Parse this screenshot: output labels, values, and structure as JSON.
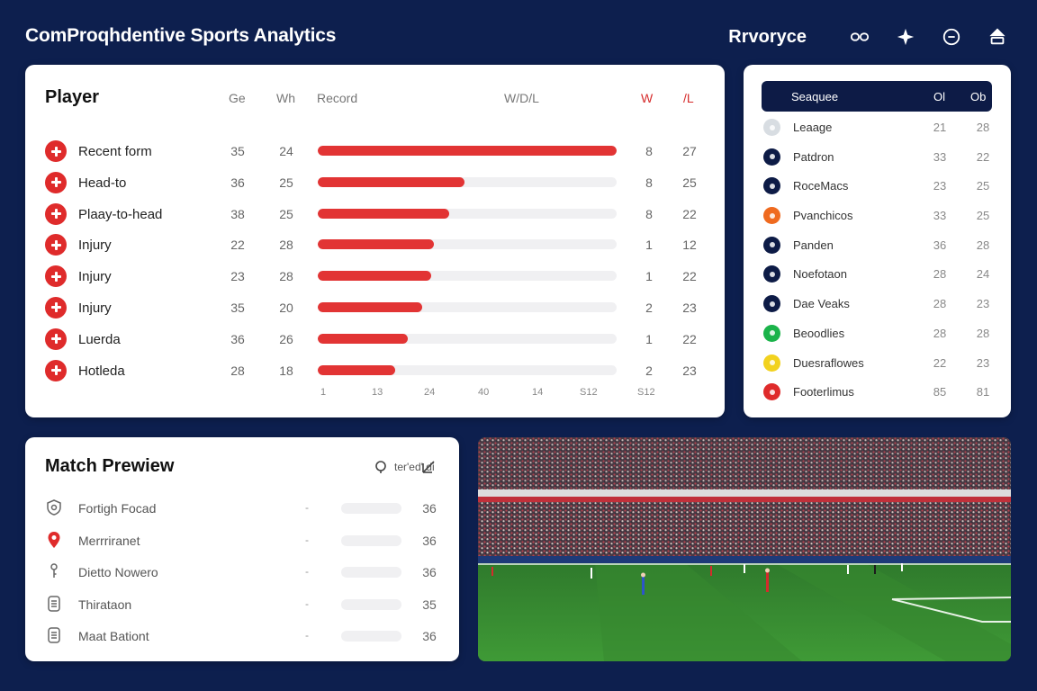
{
  "app": {
    "title": "ComProqhdentive Sports Analytics",
    "user": "Rrvoryce"
  },
  "header_icons": [
    "link-icon",
    "sparkle-icon",
    "minus-circle-icon",
    "upload-icon"
  ],
  "player_card": {
    "title": "Player",
    "columns": {
      "ge": "Ge",
      "wh": "Wh",
      "record": "Record",
      "wdl": "W/D/L",
      "w": "W",
      "l": "/L"
    },
    "rows": [
      {
        "label": "Recent form",
        "ge": "35",
        "wh": "24",
        "fill": 1.0,
        "w": "8",
        "l": "27"
      },
      {
        "label": "Head-to",
        "ge": "36",
        "wh": "25",
        "fill": 0.49,
        "w": "8",
        "l": "25"
      },
      {
        "label": "Plaay-to-head",
        "ge": "38",
        "wh": "25",
        "fill": 0.44,
        "w": "8",
        "l": "22"
      },
      {
        "label": "Injury",
        "ge": "22",
        "wh": "28",
        "fill": 0.39,
        "w": "1",
        "l": "12"
      },
      {
        "label": "Injury",
        "ge": "23",
        "wh": "28",
        "fill": 0.38,
        "w": "1",
        "l": "22"
      },
      {
        "label": "Injury",
        "ge": "35",
        "wh": "20",
        "fill": 0.35,
        "w": "2",
        "l": "23"
      },
      {
        "label": "Luerda",
        "ge": "36",
        "wh": "26",
        "fill": 0.3,
        "w": "1",
        "l": "22"
      },
      {
        "label": "Hotleda",
        "ge": "28",
        "wh": "18",
        "fill": 0.26,
        "w": "2",
        "l": "23"
      }
    ],
    "axis_ticks": [
      "1",
      "13",
      "24",
      "40",
      "14",
      "S12",
      "S12"
    ]
  },
  "league_card": {
    "header": {
      "name": "Seaquee",
      "col1": "Ol",
      "col2": "Ob"
    },
    "rows": [
      {
        "label": "Leaage",
        "a": "21",
        "b": "28",
        "color": "#d8dde2"
      },
      {
        "label": "Patdron",
        "a": "33",
        "b": "22",
        "color": "#0d1b46"
      },
      {
        "label": "RoceMacs",
        "a": "23",
        "b": "25",
        "color": "#0d1b46"
      },
      {
        "label": "Pvanchicos",
        "a": "33",
        "b": "25",
        "color": "#ef6a1f"
      },
      {
        "label": "Panden",
        "a": "36",
        "b": "28",
        "color": "#0d1b46"
      },
      {
        "label": "Noefotaon",
        "a": "28",
        "b": "24",
        "color": "#0d1b46"
      },
      {
        "label": "Dae Veaks",
        "a": "28",
        "b": "23",
        "color": "#0d1b46"
      },
      {
        "label": "Beoodlies",
        "a": "28",
        "b": "28",
        "color": "#1bb34a"
      },
      {
        "label": "Duesraflowes",
        "a": "22",
        "b": "23",
        "color": "#f2d21e"
      },
      {
        "label": "Footerlimus",
        "a": "85",
        "b": "81",
        "color": "#df2b2b"
      }
    ]
  },
  "match_preview": {
    "title": "Match Prewiew",
    "search_text": "ter'ed' di",
    "rows": [
      {
        "label": "Fortigh Focad",
        "icon": "shield-icon",
        "dash": "-",
        "value": "36"
      },
      {
        "label": "Merrriranet",
        "icon": "location-pin-icon",
        "dash": "-",
        "value": "36"
      },
      {
        "label": "Dietto Nowero",
        "icon": "key-icon",
        "dash": "-",
        "value": "36"
      },
      {
        "label": "Thirataon",
        "icon": "document-icon",
        "dash": "-",
        "value": "35"
      },
      {
        "label": "Maat Bationt",
        "icon": "document-icon",
        "dash": "-",
        "value": "36"
      }
    ]
  }
}
